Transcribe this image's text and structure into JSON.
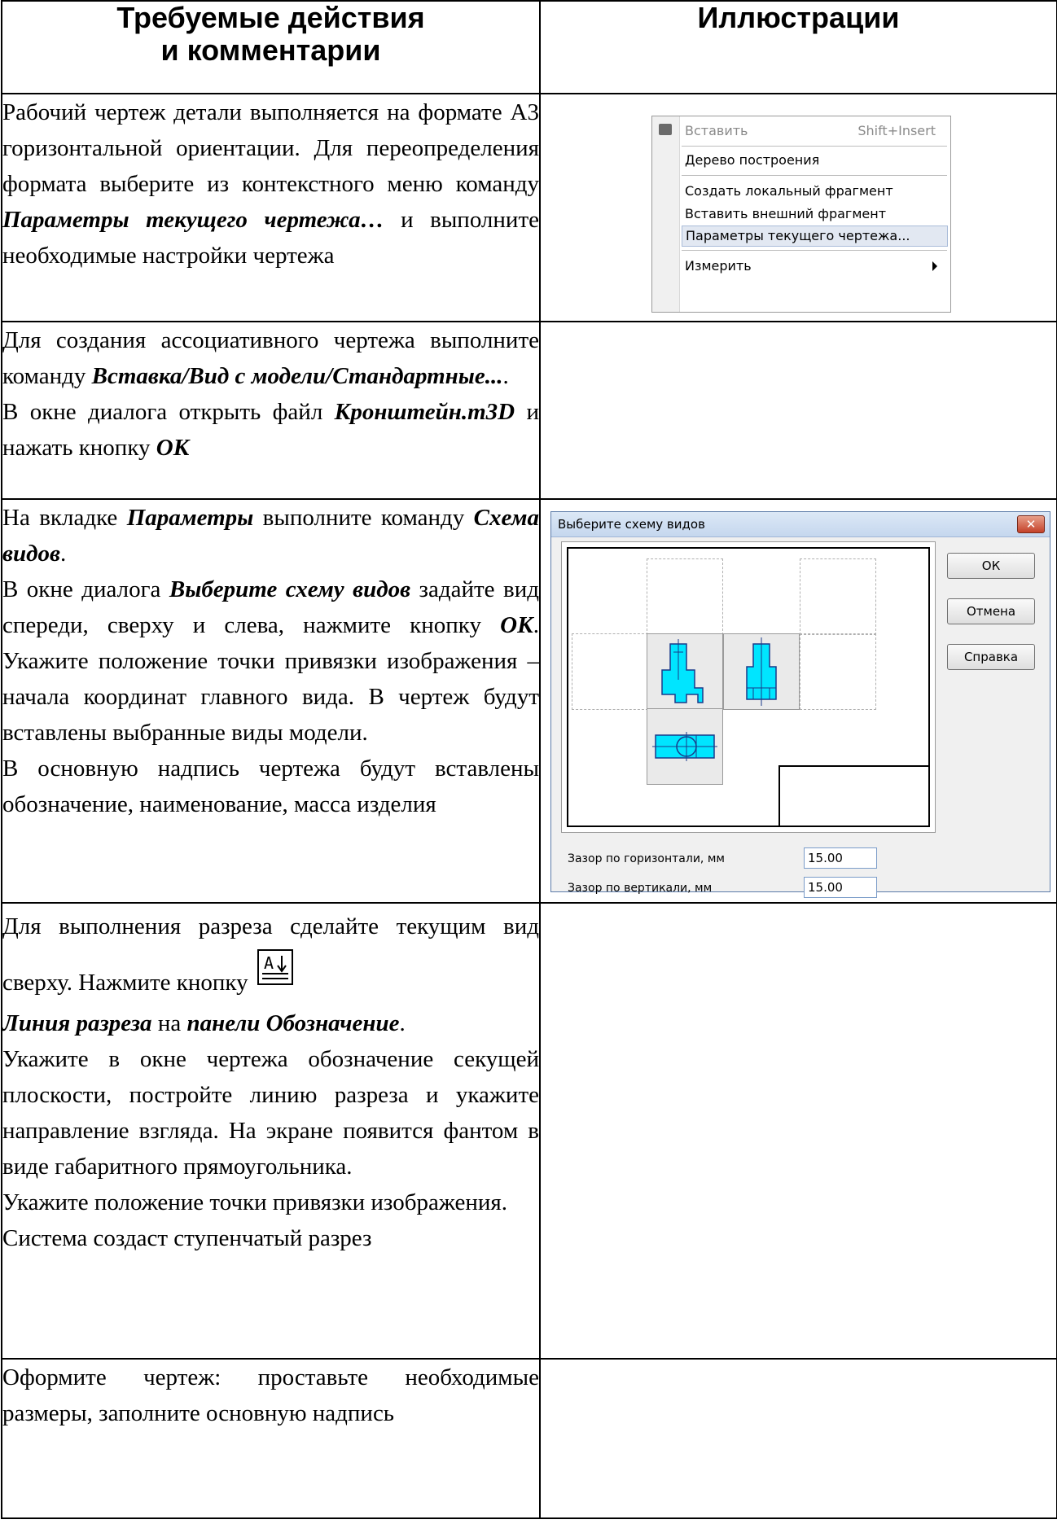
{
  "header": {
    "col1_line1": "Требуемые действия",
    "col1_line2": "и комментарии",
    "col2": "Иллюстрации"
  },
  "rows": [
    {
      "text": {
        "a": "Рабочий чертеж детали выполняется на формате А3 горизонтальной ориентации. Для переопределения формата выберите из контекстного меню команду ",
        "b": "Параметры текущего чертежа…",
        "c": " и выполните необходимые настройки чертежа"
      }
    },
    {
      "text": {
        "a": "Для создания ассоциативного чертежа выполните команду ",
        "b": "Вставка/Вид с модели/Стандартные...",
        "c": ".",
        "d": "В окне диалога открыть файл ",
        "e": "Кронштейн.m3D",
        "f": " и нажать кнопку ",
        "g": "ОК"
      }
    },
    {
      "text": {
        "a": "На вкладке ",
        "b": "Параметры",
        "c": " выполните команду ",
        "d": "Схема видов",
        "e": ".",
        "f": "В окне диалога ",
        "g": "Выберите схему видов",
        "h": " задайте вид спереди, сверху и слева, нажмите кнопку ",
        "i": "ОК",
        "j": ". Укажите положение точки привязки изображения – начала координат главного вида. В чертеж будут вставлены выбранные виды модели.",
        "k": "В основную надпись чертежа будут вставлены обозначение, наименование, масса изделия"
      }
    },
    {
      "text": {
        "a": "Для выполнения разреза сделайте текущим вид сверху. Нажмите кнопку",
        "b": "Линия разреза",
        "c": " на ",
        "d": "панели Обозначение",
        "e": ".",
        "f": "Укажите в окне чертежа обозначение секущей плоскости, постройте линию разреза и укажите направление взгляда. На экране появится фантом в виде габаритного прямоугольника.",
        "g": "Укажите положение точки привязки изображения.",
        "h": "Система создаст ступенчатый разрез"
      },
      "icon": "section-line-icon",
      "icon_label": "А"
    },
    {
      "text": {
        "a": "Оформите чертеж: проставьте необходимые размеры, заполните основную надпись"
      }
    }
  ],
  "context_menu": {
    "items": [
      {
        "label": "Вставить",
        "shortcut": "Shift+Insert",
        "disabled": true,
        "icon": "paste-icon"
      },
      {
        "label": "Дерево построения"
      },
      {
        "label": "Создать локальный фрагмент"
      },
      {
        "label": "Вставить внешний фрагмент"
      },
      {
        "label": "Параметры текущего чертежа...",
        "highlighted": true
      },
      {
        "label": "Измерить",
        "submenu": true
      }
    ]
  },
  "dialog": {
    "title": "Выберите схему видов",
    "close": "✕",
    "buttons": {
      "ok": "ОК",
      "cancel": "Отмена",
      "help": "Справка"
    },
    "gap_h_label": "Зазор по горизонтали, мм",
    "gap_h_value": "15.00",
    "gap_v_label": "Зазор по вертикали, мм",
    "gap_v_value": "15.00",
    "colors": {
      "part_fill": "#00e5ff",
      "part_stroke": "#1a3a8a"
    }
  }
}
